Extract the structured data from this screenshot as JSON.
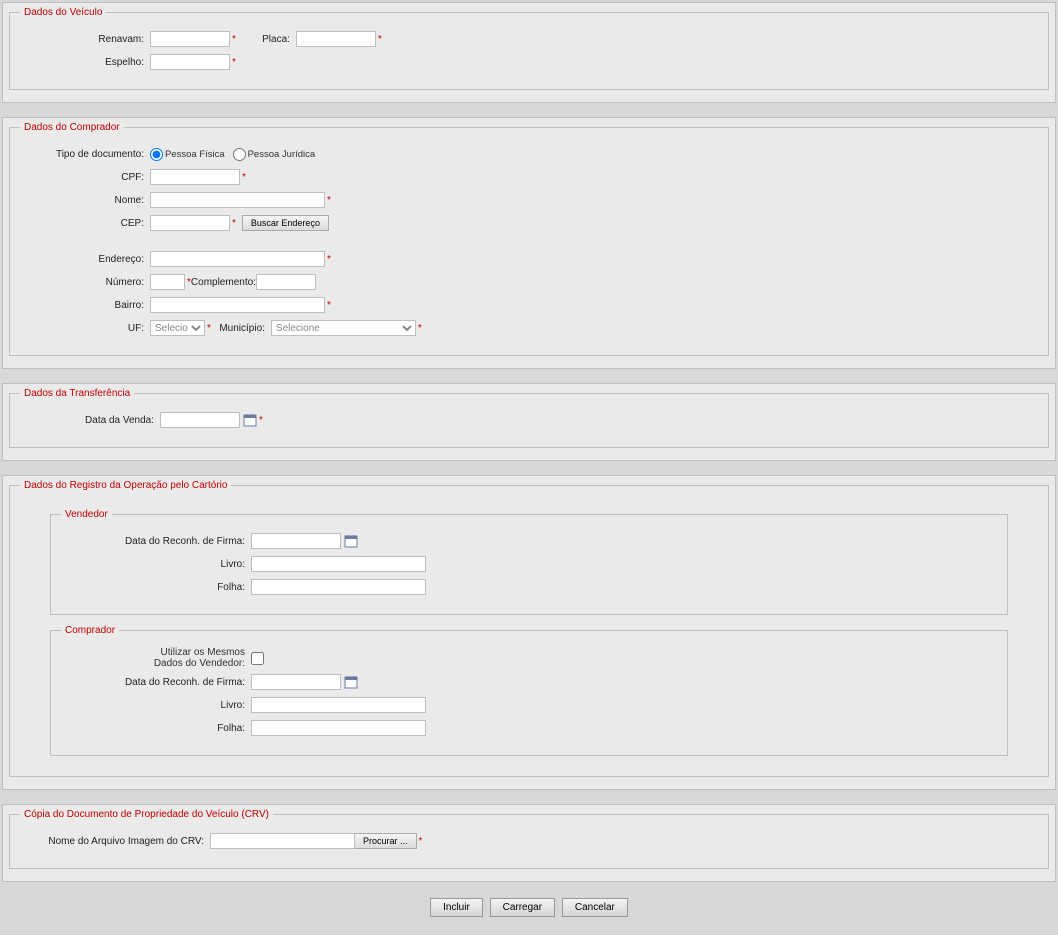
{
  "veiculo": {
    "legend": "Dados do Veículo",
    "renavam_lbl": "Renavam:",
    "placa_lbl": "Placa:",
    "espelho_lbl": "Espelho:"
  },
  "comprador": {
    "legend": "Dados do Comprador",
    "tipo_doc_lbl": "Tipo de documento:",
    "pf": "Pessoa Física",
    "pj": "Pessoa Jurídica",
    "cpf_lbl": "CPF:",
    "nome_lbl": "Nome:",
    "cep_lbl": "CEP:",
    "buscar_btn": "Buscar Endereço",
    "endereco_lbl": "Endereço:",
    "numero_lbl": "Número:",
    "complemento_lbl": "Complemento:",
    "bairro_lbl": "Bairro:",
    "uf_lbl": "UF:",
    "uf_placeholder": "Selecione",
    "municipio_lbl": "Município:",
    "municipio_placeholder": "Selecione"
  },
  "transferencia": {
    "legend": "Dados da Transferência",
    "data_venda_lbl": "Data da Venda:"
  },
  "cartorio": {
    "legend": "Dados do Registro da Operação pelo Cartório",
    "vendedor": {
      "legend": "Vendedor",
      "data_reconh_lbl": "Data do Reconh. de Firma:",
      "livro_lbl": "Livro:",
      "folha_lbl": "Folha:"
    },
    "compradorreg": {
      "legend": "Comprador",
      "mesmos_l1": "Utilizar os Mesmos",
      "mesmos_l2": "Dados do Vendedor:",
      "data_reconh_lbl": "Data do Reconh. de Firma:",
      "livro_lbl": "Livro:",
      "folha_lbl": "Folha:"
    }
  },
  "crv": {
    "legend": "Cópia do Documento de Propriedade do Veículo (CRV)",
    "arquivo_lbl": "Nome do Arquivo Imagem do CRV:",
    "procurar": "Procurar ..."
  },
  "buttons": {
    "incluir": "Incluir",
    "carregar": "Carregar",
    "cancelar": "Cancelar"
  }
}
